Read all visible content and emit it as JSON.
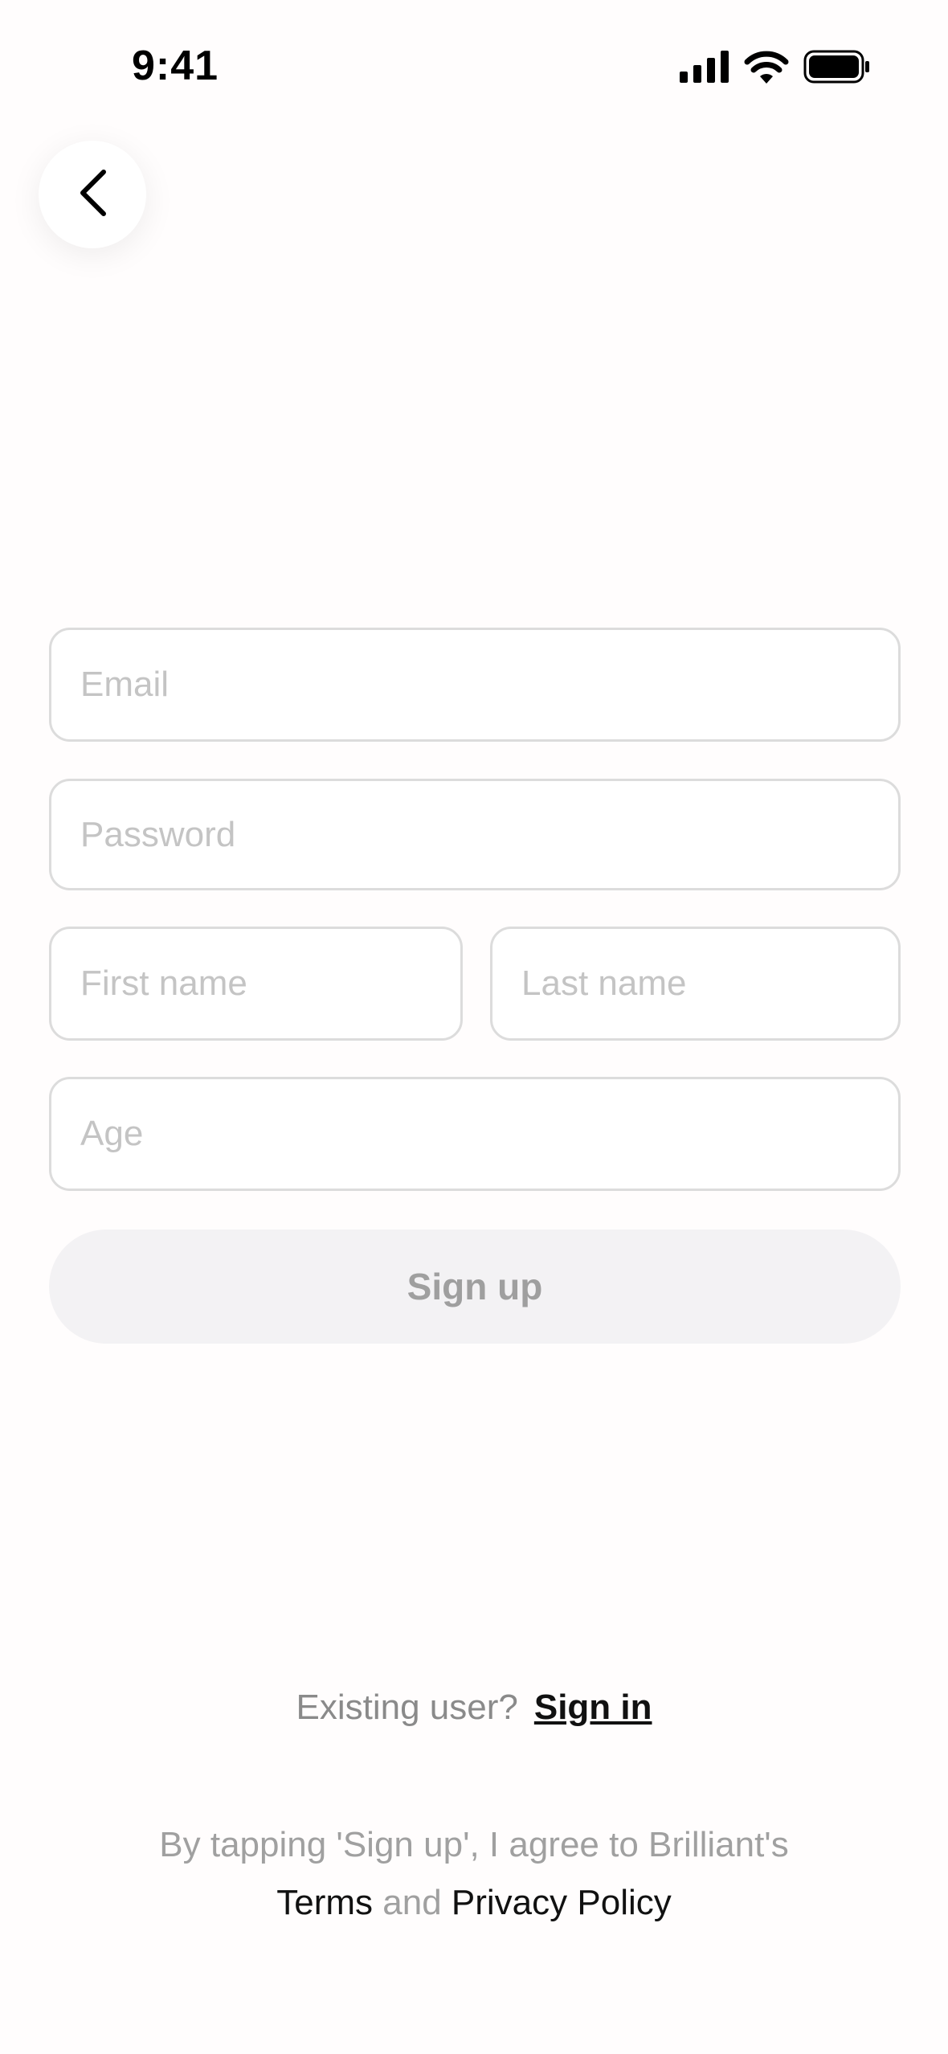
{
  "status_bar": {
    "time": "9:41"
  },
  "form": {
    "email_placeholder": "Email",
    "password_placeholder": "Password",
    "first_name_placeholder": "First name",
    "last_name_placeholder": "Last name",
    "age_placeholder": "Age",
    "signup_label": "Sign up"
  },
  "footer": {
    "existing_text": "Existing user?",
    "signin_label": "Sign in",
    "legal_line1": "By tapping 'Sign up', I agree to Brilliant's",
    "terms_label": "Terms",
    "and_text": "and",
    "privacy_label": "Privacy Policy"
  },
  "colors": {
    "background": "#fffdfd",
    "field_border": "#dcdcdc",
    "placeholder": "#c4c4c4",
    "button_bg": "#f3f2f4",
    "button_text": "#9f9f9f"
  }
}
